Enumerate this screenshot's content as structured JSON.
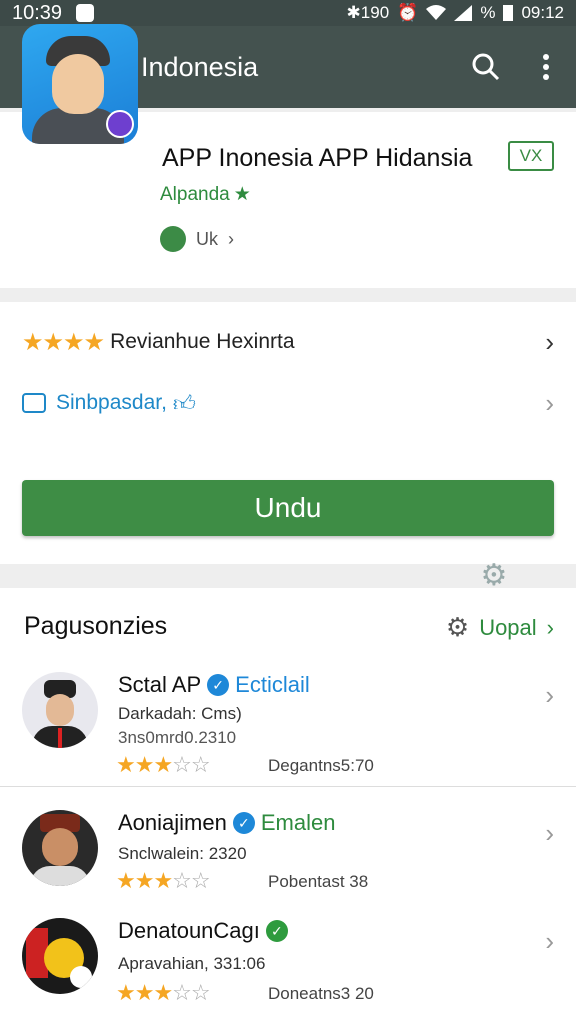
{
  "status_bar": {
    "time": "10:39",
    "indicators": "✱190",
    "battery": "%",
    "clock_right": "09:12"
  },
  "toolbar": {
    "title": "APP Indonesia"
  },
  "app": {
    "name": "APP Inonesia APP Hidansia",
    "developer": "Alpanda",
    "meta": "Uk",
    "age_badge": "VX"
  },
  "actions": {
    "reviews_label": "Revianhue Hexinrta",
    "similar_label": "Sinbpasdar,",
    "install_label": "Undu"
  },
  "similar_section": {
    "title": "Pagusonzies",
    "more_label": "Uopal",
    "items": [
      {
        "name": "Sctal AP",
        "tag": "Ecticlail",
        "sub1": "Darkadah: Cms)",
        "sub2": "3ns0mrd0.2310",
        "rating": "3.5",
        "right_text": "Degantns5:70"
      },
      {
        "name": "Aoniajimen",
        "tag": "Emalen",
        "sub1": "Snclwalein: 2320",
        "rating": "3.5",
        "right_text": "Pobentast 38"
      },
      {
        "name": "DenatounCagı",
        "sub1": "Apravahian, 331:06",
        "rating": "3.5",
        "right_text": "Doneatns3 20"
      }
    ]
  },
  "colors": {
    "toolbar": "#44524f",
    "accent_green": "#3e8d45",
    "link_blue": "#1e88c8",
    "star": "#f5a623"
  }
}
